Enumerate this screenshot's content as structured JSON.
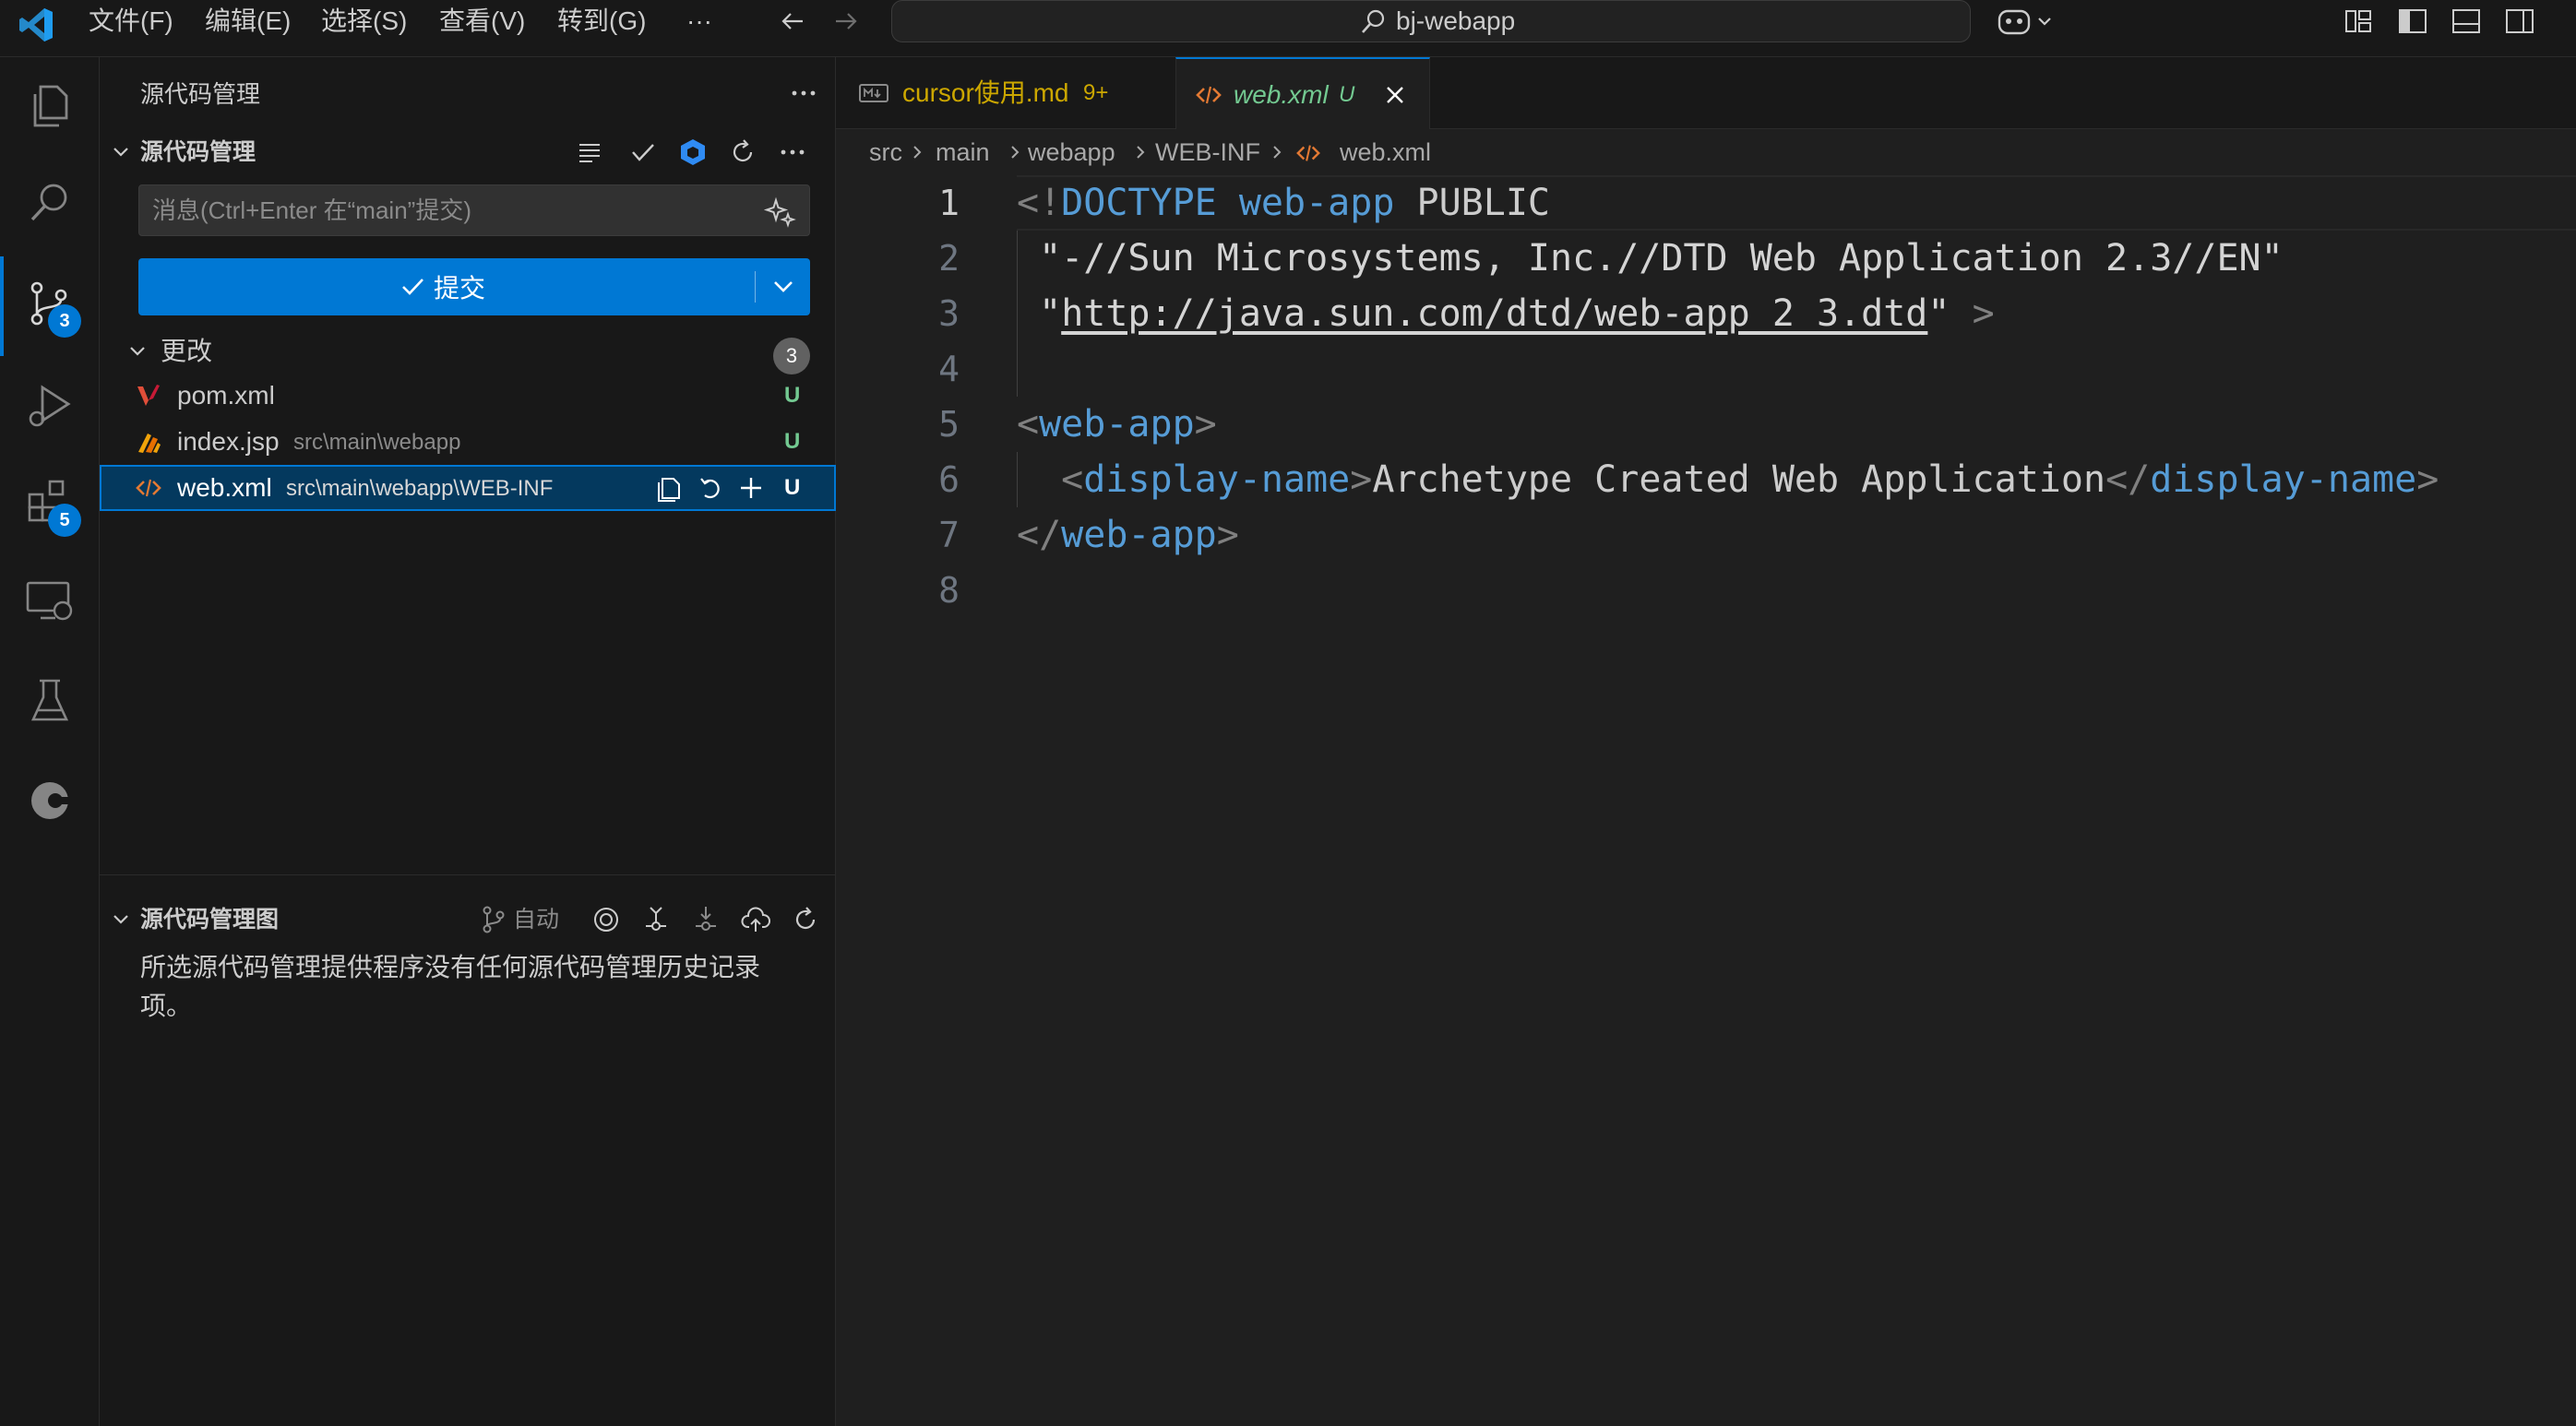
{
  "window": {
    "search_text": "bj-webapp"
  },
  "menu": [
    "文件(F)",
    "编辑(E)",
    "选择(S)",
    "查看(V)",
    "转到(G)",
    "···"
  ],
  "activity_bar": {
    "source_control_badge": "3",
    "extensions_badge": "5"
  },
  "sidebar": {
    "title": "源代码管理",
    "scm_section_title": "源代码管理",
    "commit_placeholder": "消息(Ctrl+Enter 在“main”提交)",
    "commit_label": "提交",
    "changes_label": "更改",
    "changes_count": "3",
    "files": [
      {
        "name": "pom.xml",
        "path": "",
        "status": "U"
      },
      {
        "name": "index.jsp",
        "path": "src\\main\\webapp",
        "status": "U"
      },
      {
        "name": "web.xml",
        "path": "src\\main\\webapp\\WEB-INF",
        "status": "U"
      }
    ],
    "graph_section_title": "源代码管理图",
    "graph_auto_label": "自动",
    "graph_empty_message": "所选源代码管理提供程序没有任何源代码管理历史记录项。"
  },
  "tabs": [
    {
      "name": "cursor使用.md",
      "badge": "9+",
      "active": false
    },
    {
      "name": "web.xml",
      "badge": "U",
      "active": true
    }
  ],
  "breadcrumb": [
    "src",
    "main",
    "webapp",
    "WEB-INF",
    "web.xml"
  ],
  "editor": {
    "line_numbers": [
      "1",
      "2",
      "3",
      "4",
      "5",
      "6",
      "7",
      "8"
    ],
    "current_line": "1",
    "doctype_kw": "DOCTYPE",
    "root": "web-app",
    "public_kw": "PUBLIC",
    "public_id": "\"-//Sun Microsystems, Inc.//DTD Web Application 2.3//EN\"",
    "system_id": "http://java.sun.com/dtd/web-app_2_3.dtd",
    "child_tag": "display-name",
    "display_name": "Archetype Created Web Application"
  },
  "colors": {
    "accent": "#0078d4",
    "untracked_status": "#73c991",
    "tab_modified": "#cca700",
    "xml_tag": "#569cd6"
  }
}
